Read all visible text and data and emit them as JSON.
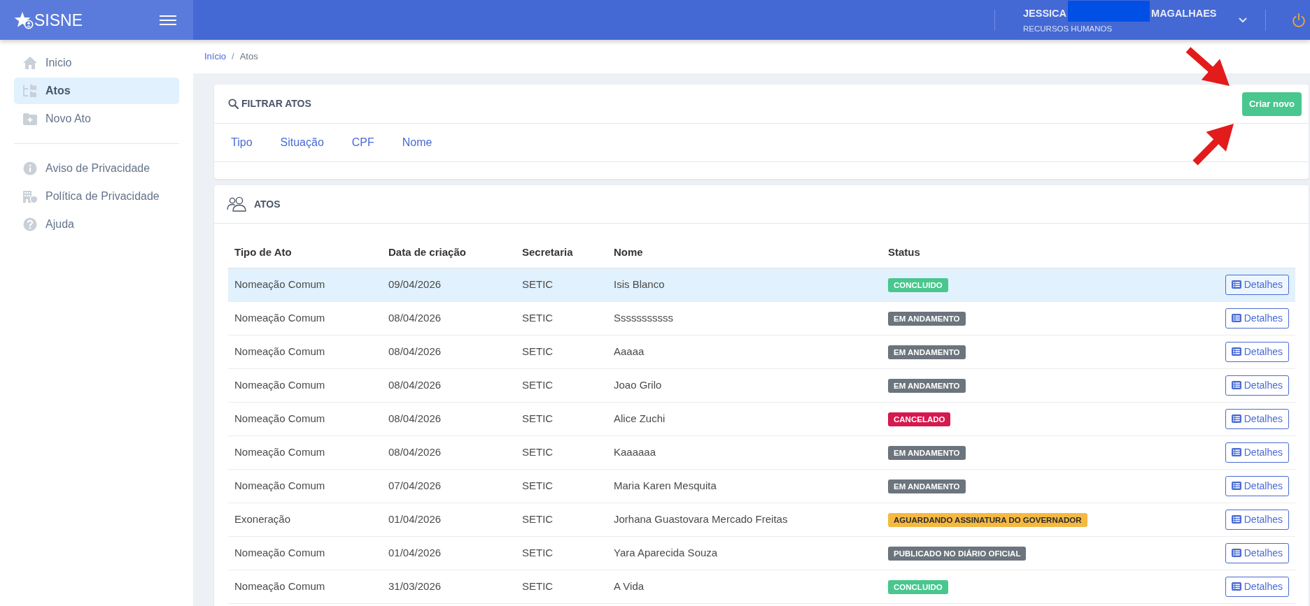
{
  "header": {
    "logo": "SISNE",
    "user": {
      "first_name": "JESSICA",
      "redacted": true,
      "last_name": "MAGALHAES",
      "department": "RECURSOS HUMANOS"
    }
  },
  "sidebar": {
    "sections": [
      {
        "items": [
          {
            "label": "Inicio",
            "selected": false
          },
          {
            "label": "Atos",
            "selected": true
          },
          {
            "label": "Novo Ato",
            "selected": false
          }
        ]
      },
      {
        "items": [
          {
            "label": "Aviso de Privacidade",
            "selected": false
          },
          {
            "label": "Política de Privacidade",
            "selected": false
          },
          {
            "label": "Ajuda",
            "selected": false
          }
        ]
      }
    ]
  },
  "breadcrumb": {
    "items": [
      "Início",
      "Atos"
    ],
    "separator": "/"
  },
  "filter_card": {
    "title": "FILTRAR ATOS",
    "button": "Criar novo",
    "filters": [
      "Tipo",
      "Situação",
      "CPF",
      "Nome"
    ]
  },
  "table_card": {
    "title": "ATOS",
    "columns": [
      "Tipo de Ato",
      "Data de criação",
      "Secretaria",
      "Nome",
      "Status"
    ],
    "rows": [
      {
        "cells": [
          "Nomeação Comum",
          "09/04/2026",
          "SETIC",
          "Isis Blanco"
        ],
        "status": {
          "label": "CONCLUIDO",
          "color": "#48c78e"
        },
        "action": "Detalhes",
        "selected": true
      },
      {
        "cells": [
          "Nomeação Comum",
          "08/04/2026",
          "SETIC",
          "Sssssssssss"
        ],
        "status": {
          "label": "EM ANDAMENTO",
          "color": "#6c757d"
        },
        "action": "Detalhes",
        "selected": false
      },
      {
        "cells": [
          "Nomeação Comum",
          "08/04/2026",
          "SETIC",
          "Aaaaa"
        ],
        "status": {
          "label": "EM ANDAMENTO",
          "color": "#6c757d"
        },
        "action": "Detalhes",
        "selected": false
      },
      {
        "cells": [
          "Nomeação Comum",
          "08/04/2026",
          "SETIC",
          "Joao Grilo"
        ],
        "status": {
          "label": "EM ANDAMENTO",
          "color": "#6c757d"
        },
        "action": "Detalhes",
        "selected": false
      },
      {
        "cells": [
          "Nomeação Comum",
          "08/04/2026",
          "SETIC",
          "Alice Zuchi"
        ],
        "status": {
          "label": "CANCELADO",
          "color": "#d6194f"
        },
        "action": "Detalhes",
        "selected": false
      },
      {
        "cells": [
          "Nomeação Comum",
          "08/04/2026",
          "SETIC",
          "Kaaaaaa"
        ],
        "status": {
          "label": "EM ANDAMENTO",
          "color": "#6c757d"
        },
        "action": "Detalhes",
        "selected": false
      },
      {
        "cells": [
          "Nomeação Comum",
          "07/04/2026",
          "SETIC",
          "Maria Karen Mesquita"
        ],
        "status": {
          "label": "EM ANDAMENTO",
          "color": "#6c757d"
        },
        "action": "Detalhes",
        "selected": false
      },
      {
        "cells": [
          "Exoneração",
          "01/04/2026",
          "SETIC",
          "Jorhana Guastovara Mercado Freitas"
        ],
        "status": {
          "label": "AGUARDANDO ASSINATURA DO GOVERNADOR",
          "color": "#f5b942"
        },
        "action": "Detalhes",
        "selected": false
      },
      {
        "cells": [
          "Nomeação Comum",
          "01/04/2026",
          "SETIC",
          "Yara Aparecida Souza"
        ],
        "status": {
          "label": "PUBLICADO NO DIÁRIO OFICIAL",
          "color": "#6c757d"
        },
        "action": "Detalhes",
        "selected": false
      },
      {
        "cells": [
          "Nomeação Comum",
          "31/03/2026",
          "SETIC",
          "A Vida"
        ],
        "status": {
          "label": "CONCLUIDO",
          "color": "#48c78e"
        },
        "action": "Detalhes",
        "selected": false
      }
    ]
  }
}
